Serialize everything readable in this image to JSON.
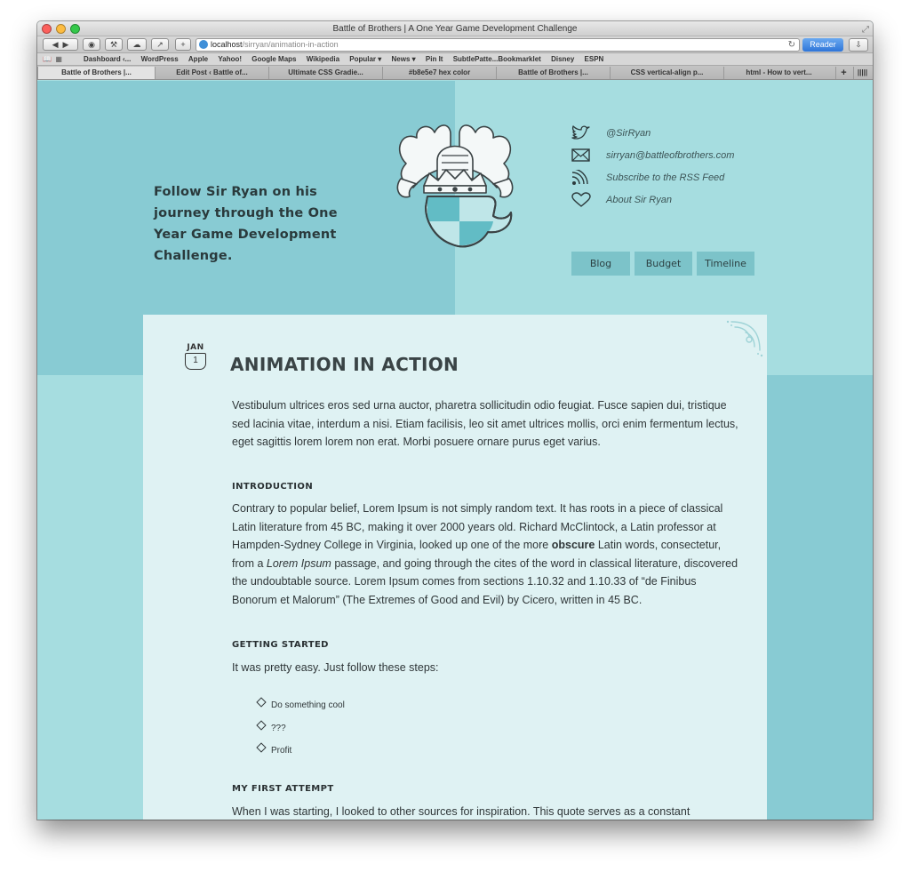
{
  "browser": {
    "window_title": "Battle of Brothers | A One Year Game Development Challenge",
    "url_host": "localhost",
    "url_path": "/sirryan/animation-in-action",
    "reader_label": "Reader",
    "bookmarks": [
      "Dashboard ‹...",
      "WordPress",
      "Apple",
      "Yahoo!",
      "Google Maps",
      "Wikipedia",
      "Popular ▾",
      "News ▾",
      "Pin It",
      "SubtlePatte...Bookmarklet",
      "Disney",
      "ESPN"
    ],
    "tabs": [
      "Battle of Brothers |...",
      "Edit Post ‹ Battle of...",
      "Ultimate CSS Gradie...",
      "#b8e5e7 hex color",
      "Battle of Brothers |...",
      "CSS vertical-align p...",
      "html - How to vert..."
    ],
    "new_tab_label": "+",
    "tab_overview_label": "|||||"
  },
  "header": {
    "tagline": "Follow Sir Ryan on his journey through the One Year Game Development Challenge.",
    "social": {
      "twitter": "@SirRyan",
      "email": "sirryan@battleofbrothers.com",
      "rss": "Subscribe to the RSS Feed",
      "about": "About Sir Ryan"
    },
    "nav": [
      "Blog",
      "Budget",
      "Timeline"
    ]
  },
  "post": {
    "date_month": "JAN",
    "date_day": "1",
    "title": "ANIMATION IN ACTION",
    "intro_para": "Vestibulum ultrices eros sed urna auctor, pharetra sollicitudin odio feugiat. Fusce sapien dui, tristique sed lacinia vitae, interdum a nisi. Etiam facilisis, leo sit amet ultrices mollis, orci enim fermentum lectus, eget sagittis lorem lorem non erat. Morbi posuere ornare purus eget varius.",
    "sections": {
      "introduction_head": "INTRODUCTION",
      "introduction_p1": "Contrary to popular belief, Lorem Ipsum is not simply random text. It has roots in a piece of classical Latin literature from 45 BC, making it over 2000 years old. Richard McClintock, a Latin professor at Hampden-Sydney College in Virginia, looked up one of the more ",
      "introduction_bold": "obscure",
      "introduction_p2": " Latin words, consectetur, from a ",
      "introduction_italic": "Lorem Ipsum",
      "introduction_p3": " passage, and going through the cites of the word in classical literature, discovered the undoubtable source. Lorem Ipsum comes from sections 1.10.32 and 1.10.33 of “de Finibus Bonorum et Malorum” (The Extremes of Good and Evil) by Cicero, written in 45 BC.",
      "getting_started_head": "GETTING STARTED",
      "getting_started_text": "It was pretty easy. Just follow these steps:",
      "steps": [
        "Do something cool",
        "???",
        "Profit"
      ],
      "first_attempt_head": "MY FIRST ATTEMPT",
      "first_attempt_text": "When I was starting, I looked to other sources for inspiration. This quote serves as a constant reminder."
    }
  },
  "colors": {
    "page_light": "#a6dde0",
    "page_dark": "#88cbd3",
    "article_bg": "#dff2f3",
    "nav_bg": "#7cc3c9"
  }
}
